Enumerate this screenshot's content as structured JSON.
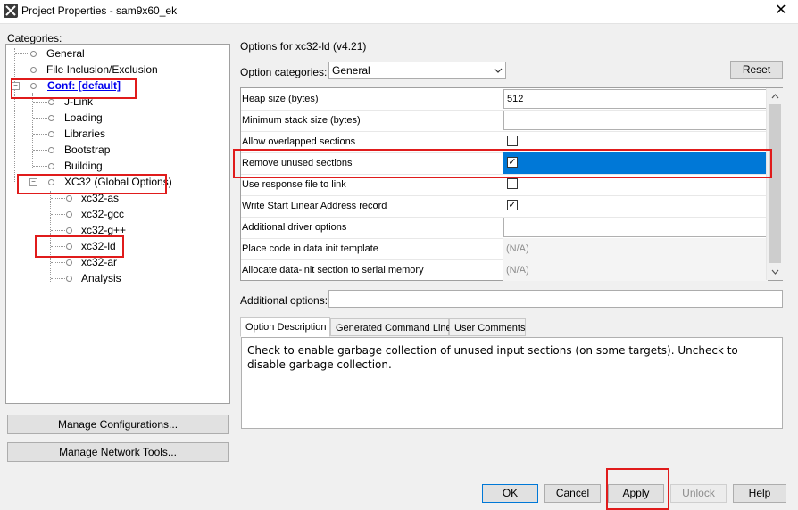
{
  "window": {
    "title": "Project Properties - sam9x60_ek",
    "close_glyph": "✕"
  },
  "categories": {
    "label": "Categories:",
    "items": [
      {
        "label": "General"
      },
      {
        "label": "File Inclusion/Exclusion"
      },
      {
        "label": "Conf: [default]"
      },
      {
        "label": "J-Link"
      },
      {
        "label": "Loading"
      },
      {
        "label": "Libraries"
      },
      {
        "label": "Bootstrap"
      },
      {
        "label": "Building"
      },
      {
        "label": "XC32 (Global Options)"
      },
      {
        "label": "xc32-as"
      },
      {
        "label": "xc32-gcc"
      },
      {
        "label": "xc32-g++"
      },
      {
        "label": "xc32-ld"
      },
      {
        "label": "xc32-ar"
      },
      {
        "label": "Analysis"
      }
    ]
  },
  "left_buttons": {
    "manage_configurations": "Manage Configurations...",
    "manage_network_tools": "Manage Network Tools..."
  },
  "options": {
    "header": "Options for xc32-ld (v4.21)",
    "category_label": "Option categories:",
    "category_value": "General",
    "reset_label": "Reset",
    "rows": [
      {
        "name": "Heap size (bytes)",
        "value": "512"
      },
      {
        "name": "Minimum stack size (bytes)",
        "value": ""
      },
      {
        "name": "Allow overlapped sections",
        "value": ""
      },
      {
        "name": "Remove unused sections",
        "value": ""
      },
      {
        "name": "Use response file to link",
        "value": ""
      },
      {
        "name": "Write Start Linear Address record",
        "value": ""
      },
      {
        "name": "Additional driver options",
        "value": ""
      },
      {
        "name": "Place code in data init template",
        "value": "(N/A)"
      },
      {
        "name": "Allocate data-init section to serial memory",
        "value": "(N/A)"
      }
    ],
    "additional_label": "Additional options:",
    "additional_value": ""
  },
  "tabs": [
    {
      "label": "Option Description"
    },
    {
      "label": "Generated Command Line"
    },
    {
      "label": "User Comments"
    }
  ],
  "description": "Check to enable garbage collection of unused input sections (on some targets). Uncheck to disable garbage collection.",
  "footer": {
    "ok": "OK",
    "cancel": "Cancel",
    "apply": "Apply",
    "unlock": "Unlock",
    "help": "Help"
  },
  "colors": {
    "highlight_border": "#e01b1b",
    "selected_row": "#0078d7",
    "link": "#0000ee"
  }
}
